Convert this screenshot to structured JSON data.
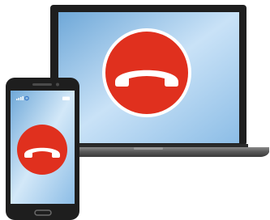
{
  "scene": {
    "background_color": "#ffffff"
  },
  "laptop": {
    "bezel_color": "#1e1e1e",
    "screen_gradient": [
      "#6fa8d8",
      "#c9e2f7",
      "#8cbde6"
    ],
    "base_color": "#4a4a4a",
    "base_highlight": "#7a7a7a",
    "call_button": {
      "icon": "hang-up-phone-icon",
      "fill": "#e0301e",
      "ring": "#ffffff",
      "glyph_color": "#ffffff"
    }
  },
  "phone": {
    "body_color": "#1e1e1e",
    "screen_gradient": [
      "#6fa8d8",
      "#d3e8f8",
      "#8cbde6"
    ],
    "status_bar": {
      "signal_icon": "signal-bars-icon",
      "alarm_icon": "alarm-icon",
      "battery_icon": "battery-icon"
    },
    "call_button": {
      "icon": "hang-up-phone-icon",
      "fill": "#e0301e",
      "glyph_color": "#ffffff"
    },
    "home_button_icon": "home-button-icon"
  }
}
